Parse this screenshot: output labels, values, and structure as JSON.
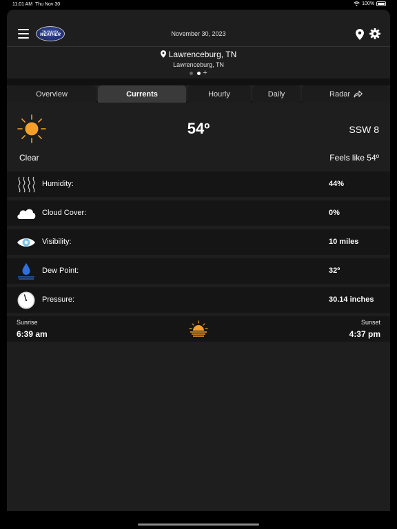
{
  "status_bar": {
    "time": "11:01 AM",
    "date": "Thu Nov 30",
    "battery": "100%"
  },
  "header": {
    "logo_top": "TN VALLEY",
    "logo_main": "WEATHER",
    "date": "November 30, 2023",
    "location_city": "Lawrenceburg, TN",
    "location_sub": "Lawrenceburg, TN"
  },
  "tabs": [
    {
      "label": "Overview"
    },
    {
      "label": "Currents"
    },
    {
      "label": "Hourly"
    },
    {
      "label": "Daily"
    },
    {
      "label": "Radar"
    }
  ],
  "current": {
    "condition": "Clear",
    "temperature": "54º",
    "wind": "SSW 8",
    "feels_like": "Feels like 54º"
  },
  "details": [
    {
      "icon": "humidity-icon",
      "label": "Humidity:",
      "value": "44%"
    },
    {
      "icon": "cloud-icon",
      "label": "Cloud Cover:",
      "value": "0%"
    },
    {
      "icon": "eye-icon",
      "label": "Visibility:",
      "value": "10 miles"
    },
    {
      "icon": "dew-drop-icon",
      "label": "Dew Point:",
      "value": "32º"
    },
    {
      "icon": "gauge-icon",
      "label": "Pressure:",
      "value": "30.14 inches"
    }
  ],
  "sun": {
    "sunrise_label": "Sunrise",
    "sunrise_time": "6:39 am",
    "sunset_label": "Sunset",
    "sunset_time": "4:37 pm"
  },
  "colors": {
    "accent_sun": "#f5a028",
    "water": "#2f6fe0"
  }
}
